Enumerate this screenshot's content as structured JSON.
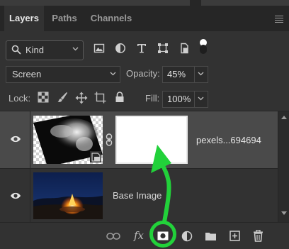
{
  "tabs": [
    {
      "label": "Layers",
      "active": true
    },
    {
      "label": "Paths",
      "active": false
    },
    {
      "label": "Channels",
      "active": false
    }
  ],
  "filter": {
    "kind_label": "Kind",
    "icons": [
      "image-filter-icon",
      "adjustment-filter-icon",
      "type-filter-icon",
      "shape-filter-icon",
      "smart-object-filter-icon",
      "filter-toggle-icon"
    ]
  },
  "blend": {
    "mode": "Screen",
    "opacity_label": "Opacity:",
    "opacity_value": "45%"
  },
  "lock": {
    "label": "Lock:",
    "icons": [
      "lock-transparent-pixels-icon",
      "lock-image-pixels-icon",
      "lock-position-icon",
      "lock-artboard-icon",
      "lock-all-icon"
    ],
    "fill_label": "Fill:",
    "fill_value": "100%"
  },
  "layers": [
    {
      "name": "pexels...694694",
      "selected": true,
      "has_mask": true
    },
    {
      "name": "Base Image",
      "selected": false,
      "has_mask": false
    }
  ],
  "bottom": {
    "fx_label": "fx",
    "icons": [
      "link-layers-icon",
      "layer-style-icon",
      "add-layer-mask-icon",
      "adjustment-layer-icon",
      "new-group-icon",
      "new-layer-icon",
      "delete-layer-icon"
    ]
  },
  "colors": {
    "panel_bg": "#323232",
    "selected_row": "#4a4a4a",
    "annotation_green": "#22d13a"
  }
}
